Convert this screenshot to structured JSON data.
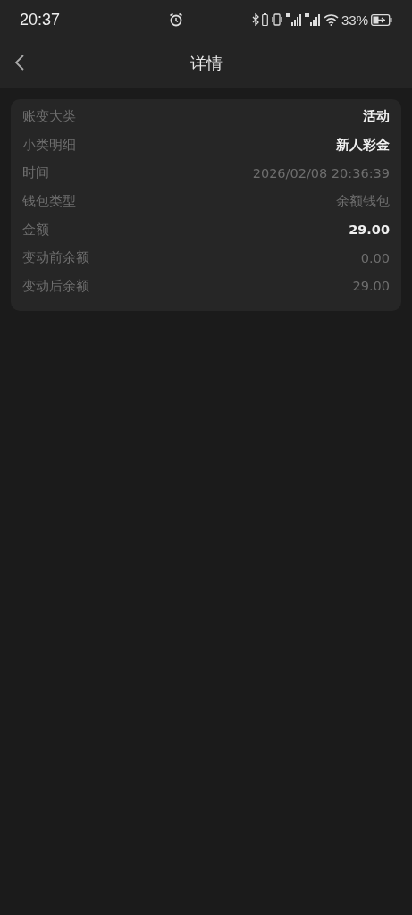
{
  "status_bar": {
    "time": "20:37",
    "battery": "33%"
  },
  "header": {
    "title": "详情"
  },
  "details": [
    {
      "label": "账变大类",
      "value": "活动",
      "kind": "strong"
    },
    {
      "label": "小类明细",
      "value": "新人彩金",
      "kind": "strong"
    },
    {
      "label": "时间",
      "value": "2026/02/08 20:36:39",
      "kind": "plain"
    },
    {
      "label": "钱包类型",
      "value": "余额钱包",
      "kind": "plain"
    },
    {
      "label": "金额",
      "value": "29.00",
      "kind": "strong"
    },
    {
      "label": "变动前余额",
      "value": "0.00",
      "kind": "plain"
    },
    {
      "label": "变动后余额",
      "value": "29.00",
      "kind": "plain"
    }
  ]
}
